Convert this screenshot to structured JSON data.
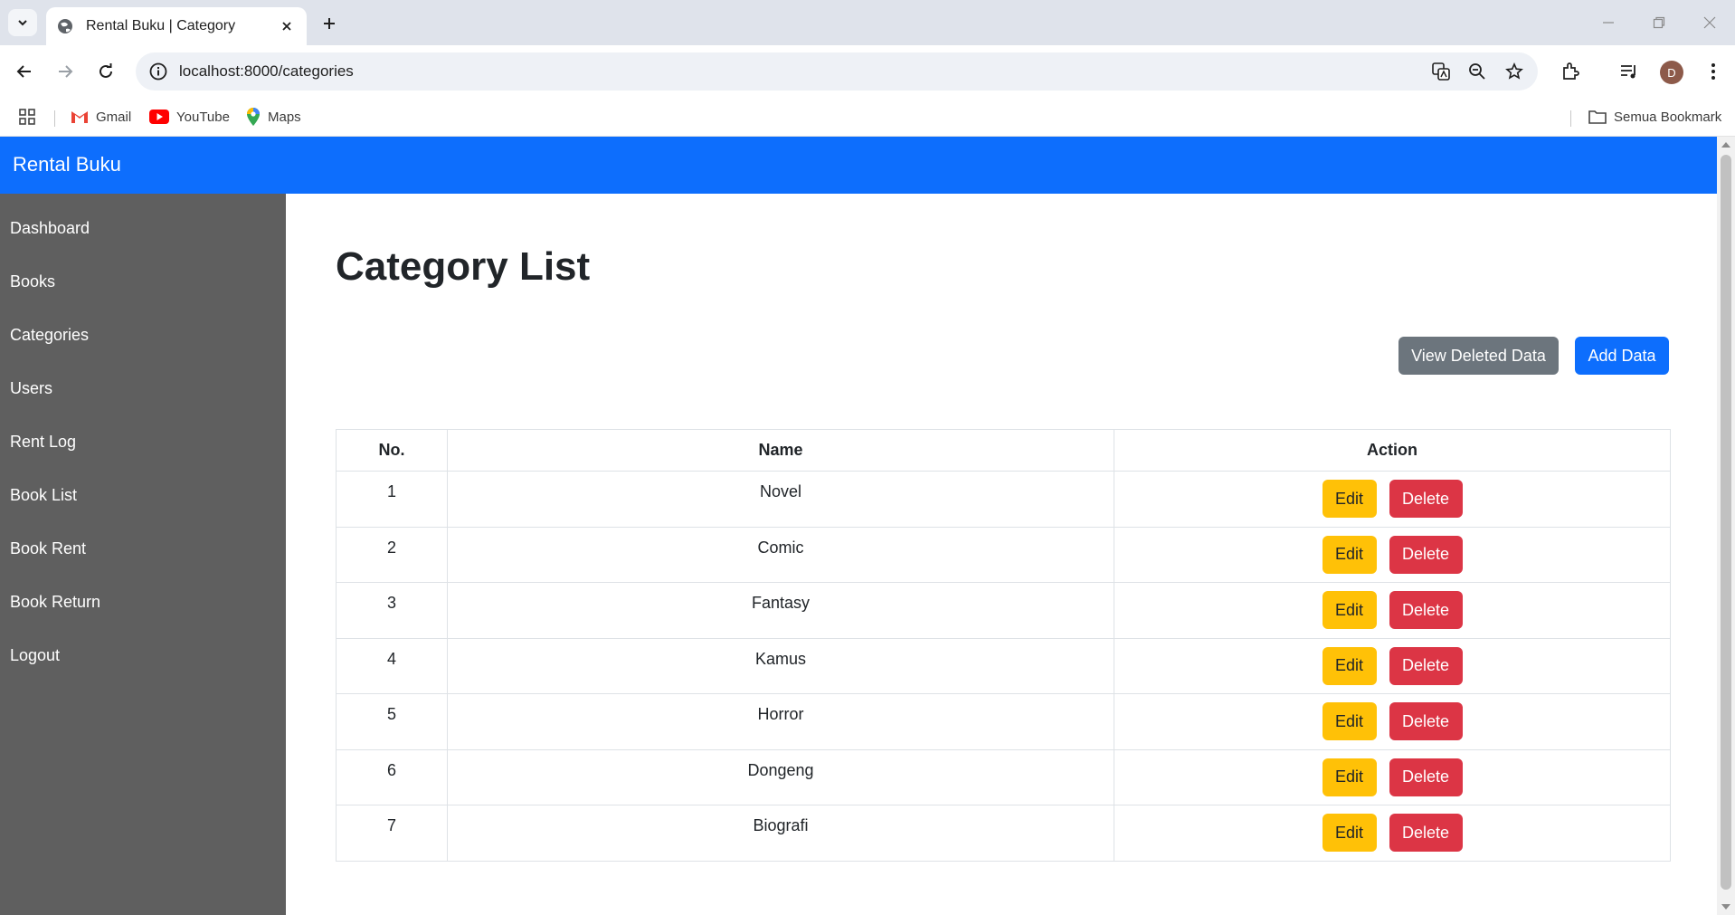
{
  "browser": {
    "tab_title": "Rental Buku | Category",
    "url": "localhost:8000/categories",
    "avatar_letter": "D",
    "bookmarks": [
      {
        "label": "Gmail",
        "icon": "gmail-icon"
      },
      {
        "label": "YouTube",
        "icon": "youtube-icon"
      },
      {
        "label": "Maps",
        "icon": "maps-icon"
      }
    ],
    "all_bookmarks_label": "Semua Bookmark"
  },
  "app": {
    "brand": "Rental Buku",
    "colors": {
      "navbar": "#0d6efd",
      "sidebar": "#5f5f5f",
      "edit": "#ffc107",
      "delete": "#dc3545",
      "secondary": "#6c757d"
    }
  },
  "sidebar": {
    "items": [
      {
        "label": "Dashboard"
      },
      {
        "label": "Books"
      },
      {
        "label": "Categories"
      },
      {
        "label": "Users"
      },
      {
        "label": "Rent Log"
      },
      {
        "label": "Book List"
      },
      {
        "label": "Book Rent"
      },
      {
        "label": "Book Return"
      },
      {
        "label": "Logout"
      }
    ]
  },
  "main": {
    "title": "Category List",
    "view_deleted_label": "View Deleted Data",
    "add_label": "Add Data",
    "table": {
      "headers": [
        "No.",
        "Name",
        "Action"
      ],
      "rows": [
        {
          "no": "1",
          "name": "Novel"
        },
        {
          "no": "2",
          "name": "Comic"
        },
        {
          "no": "3",
          "name": "Fantasy"
        },
        {
          "no": "4",
          "name": "Kamus"
        },
        {
          "no": "5",
          "name": "Horror"
        },
        {
          "no": "6",
          "name": "Dongeng"
        },
        {
          "no": "7",
          "name": "Biografi"
        }
      ],
      "edit_label": "Edit",
      "delete_label": "Delete"
    }
  }
}
